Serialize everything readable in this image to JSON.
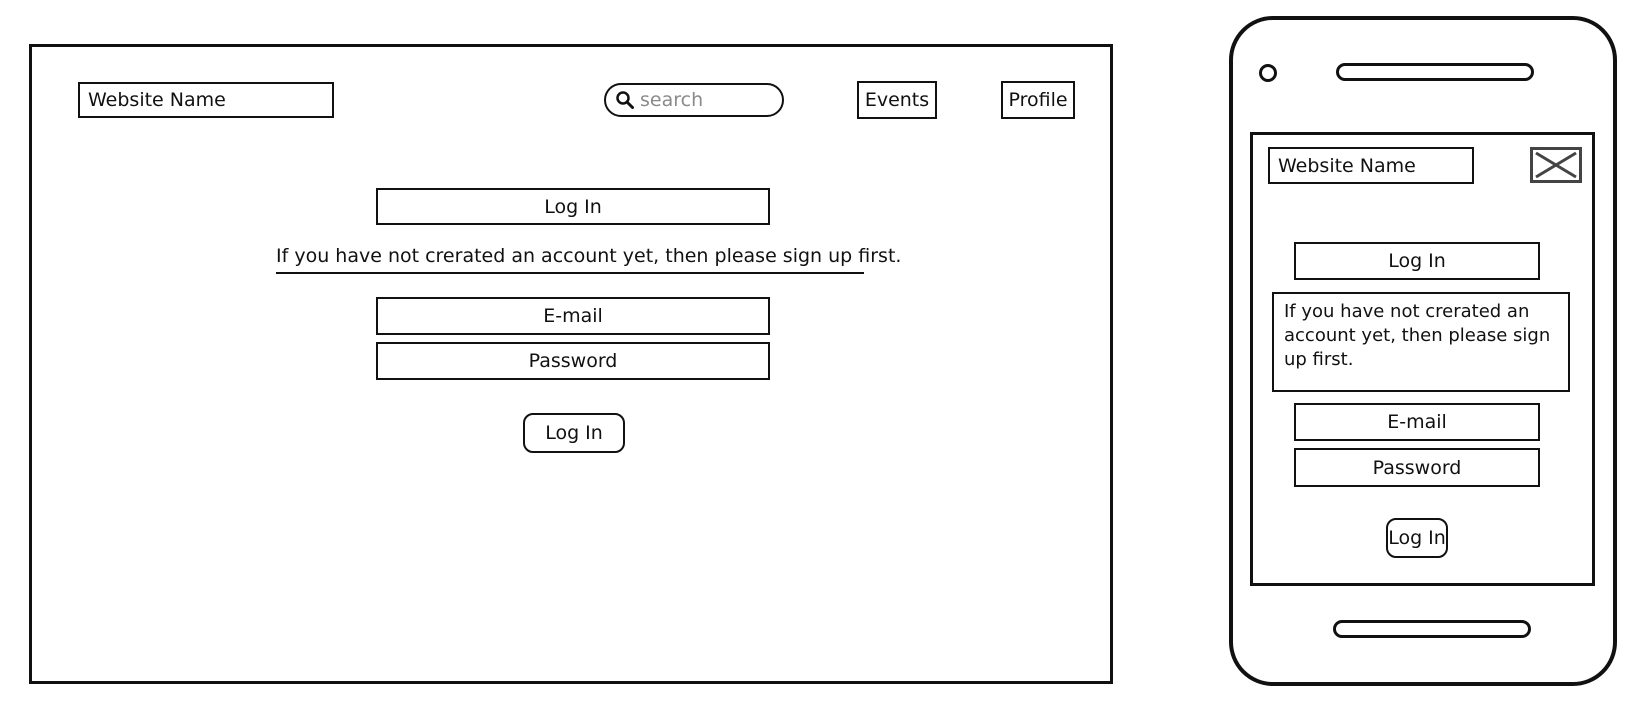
{
  "desktop": {
    "website_name": "Website Name",
    "search_placeholder": "search",
    "nav": {
      "events": "Events",
      "profile": "Profile"
    },
    "login_heading": "Log In",
    "message": "If you have not crerated an account yet, then please sign up first.",
    "email_field": "E-mail",
    "password_field": "Password",
    "login_button": "Log In"
  },
  "mobile": {
    "website_name": "Website Name",
    "close_icon": "close-x-icon",
    "login_heading": "Log In",
    "message": "If you have not crerated an account yet, then please sign up first.",
    "email_field": "E-mail",
    "password_field": "Password",
    "login_button": "Log In"
  },
  "icons": {
    "search": "search-icon",
    "close": "close-icon"
  },
  "colors": {
    "stroke": "#111111",
    "placeholder": "#8a8a8a",
    "close_stroke": "#444444"
  }
}
